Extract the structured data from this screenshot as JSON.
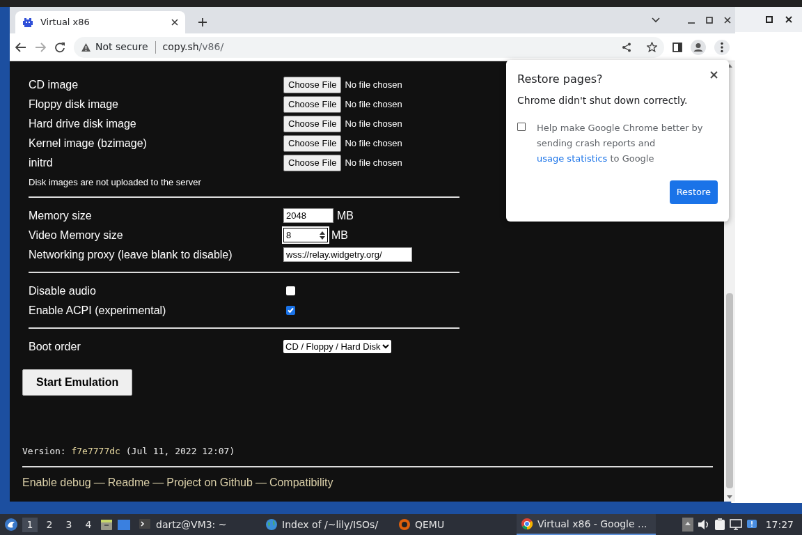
{
  "browser": {
    "tab_title": "Virtual x86",
    "security_label": "Not secure",
    "url_host": "copy.sh",
    "url_path": "/v86/"
  },
  "setup": {
    "file_rows": [
      {
        "label": "CD image",
        "button": "Choose File",
        "status": "No file chosen"
      },
      {
        "label": "Floppy disk image",
        "button": "Choose File",
        "status": "No file chosen"
      },
      {
        "label": "Hard drive disk image",
        "button": "Choose File",
        "status": "No file chosen"
      },
      {
        "label": "Kernel image (bzimage)",
        "button": "Choose File",
        "status": "No file chosen"
      },
      {
        "label": "initrd",
        "button": "Choose File",
        "status": "No file chosen"
      }
    ],
    "note": "Disk images are not uploaded to the server",
    "fields": [
      {
        "label": "Memory size",
        "value": "2048",
        "unit": "MB",
        "kind": "text",
        "focused": false
      },
      {
        "label": "Video Memory size",
        "value": "8",
        "unit": "MB",
        "kind": "number",
        "focused": true
      },
      {
        "label": "Networking proxy (leave blank to disable)",
        "value": "wss://relay.widgetry.org/",
        "kind": "wide",
        "focused": false
      }
    ],
    "checkboxes": [
      {
        "label": "Disable audio",
        "checked": false
      },
      {
        "label": "Enable ACPI (experimental)",
        "checked": true
      }
    ],
    "boot_order": {
      "label": "Boot order",
      "value": "CD / Floppy / Hard Disk"
    },
    "start_button": "Start Emulation"
  },
  "version": {
    "label": "Version:",
    "hash": "f7e7777dc",
    "date": "(Jul 11, 2022 12:07)"
  },
  "footer": {
    "separator": "—",
    "links": [
      "Enable debug",
      "Readme",
      "Project on Github",
      "Compatibility"
    ]
  },
  "dialog": {
    "title": "Restore pages?",
    "message": "Chrome didn't shut down correctly.",
    "checked": false,
    "text": "Help make Google Chrome better by sending crash reports and",
    "link": "usage statistics",
    "text_after": "to Google",
    "button": "Restore"
  },
  "taskbar": {
    "workspaces": [
      {
        "label": "1",
        "selected": true
      },
      {
        "label": "2",
        "selected": false
      },
      {
        "label": "3",
        "selected": false
      },
      {
        "label": "4",
        "selected": false
      }
    ],
    "tasks": [
      {
        "label": "dartz@VM3: ~",
        "kind": "terminal",
        "selected": false
      },
      {
        "label": "Index of /~lily/ISOs/",
        "kind": "globe",
        "selected": false
      },
      {
        "label": "QEMU",
        "kind": "qemu",
        "selected": false
      },
      {
        "label": "Virtual x86 - Google ...",
        "kind": "chrome",
        "selected": true
      }
    ],
    "clock": "17:27"
  }
}
